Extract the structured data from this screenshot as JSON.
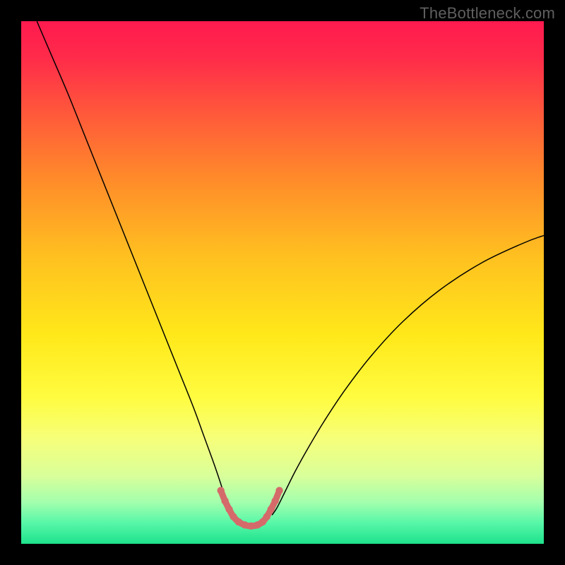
{
  "watermark": "TheBottleneck.com",
  "chart_data": {
    "type": "line",
    "title": "",
    "xlabel": "",
    "ylabel": "",
    "xlim": [
      0,
      100
    ],
    "ylim": [
      0,
      100
    ],
    "grid": false,
    "legend": false,
    "background": {
      "type": "vertical-gradient",
      "stops": [
        {
          "offset": 0.0,
          "color": "#ff1a4f"
        },
        {
          "offset": 0.07,
          "color": "#ff2b4a"
        },
        {
          "offset": 0.18,
          "color": "#ff5a3a"
        },
        {
          "offset": 0.3,
          "color": "#ff8a2a"
        },
        {
          "offset": 0.45,
          "color": "#ffc020"
        },
        {
          "offset": 0.6,
          "color": "#ffe81a"
        },
        {
          "offset": 0.72,
          "color": "#fffc40"
        },
        {
          "offset": 0.8,
          "color": "#f6ff7a"
        },
        {
          "offset": 0.87,
          "color": "#d9ff9a"
        },
        {
          "offset": 0.92,
          "color": "#a4ffad"
        },
        {
          "offset": 0.96,
          "color": "#57f7a8"
        },
        {
          "offset": 1.0,
          "color": "#1ee28c"
        }
      ]
    },
    "left_curve": {
      "color": "#000000",
      "width": 1.5,
      "x": [
        3,
        6,
        9,
        12,
        15,
        18,
        21,
        24,
        27,
        30,
        33,
        35,
        37,
        38.5,
        39.5,
        40
      ],
      "y": [
        100,
        93,
        86,
        78.5,
        71,
        63.5,
        56,
        48.5,
        41,
        33.5,
        26,
        20.5,
        15,
        10.5,
        7,
        5.5
      ]
    },
    "right_curve": {
      "color": "#000000",
      "width": 1.5,
      "x": [
        48,
        49,
        50.5,
        52.5,
        55,
        58,
        62,
        67,
        73,
        80,
        88,
        96,
        100
      ],
      "y": [
        5.5,
        7,
        10,
        14,
        18.5,
        23.5,
        29.5,
        36,
        42.5,
        48.5,
        53.7,
        57.5,
        59
      ]
    },
    "highlight_segment": {
      "color": "#d56a6a",
      "width": 9,
      "linecap": "round",
      "dots": {
        "radius": 5.2,
        "color": "#d56a6a"
      },
      "x": [
        38.2,
        39.0,
        39.8,
        40.6,
        41.6,
        42.8,
        44.0,
        45.2,
        46.2,
        47.0,
        47.8,
        48.6,
        49.4
      ],
      "y": [
        10.2,
        8.2,
        6.6,
        5.2,
        4.2,
        3.6,
        3.4,
        3.6,
        4.2,
        5.2,
        6.6,
        8.2,
        10.2
      ]
    }
  }
}
